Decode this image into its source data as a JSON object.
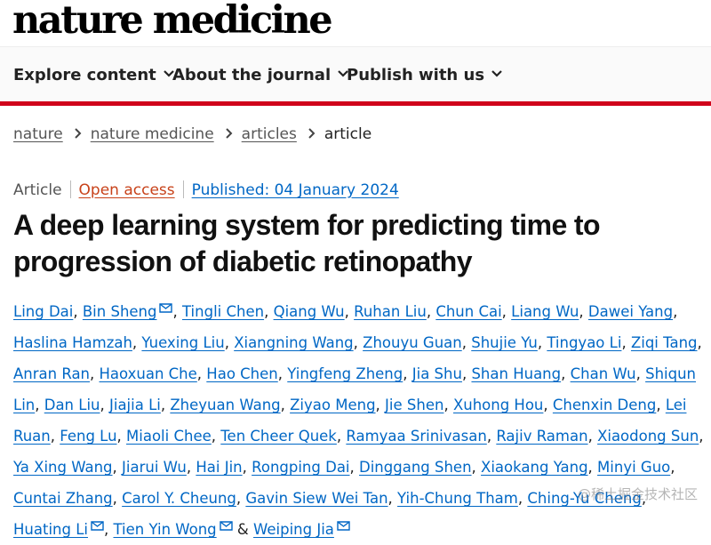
{
  "header": {
    "logo": "nature medicine"
  },
  "nav": {
    "items": [
      {
        "label": "Explore content"
      },
      {
        "label": "About the journal"
      },
      {
        "label": "Publish with us"
      }
    ]
  },
  "breadcrumb": [
    "nature",
    "nature medicine",
    "articles",
    "article"
  ],
  "meta": {
    "type": "Article",
    "access": "Open access",
    "published": "Published: 04 January 2024"
  },
  "article": {
    "title": "A deep learning system for predicting time to progression of diabetic retinopathy"
  },
  "authors": [
    {
      "name": "Ling Dai",
      "mail": false
    },
    {
      "name": "Bin Sheng",
      "mail": true
    },
    {
      "name": "Tingli Chen",
      "mail": false
    },
    {
      "name": "Qiang Wu",
      "mail": false
    },
    {
      "name": "Ruhan Liu",
      "mail": false
    },
    {
      "name": "Chun Cai",
      "mail": false
    },
    {
      "name": "Liang Wu",
      "mail": false
    },
    {
      "name": "Dawei Yang",
      "mail": false
    },
    {
      "name": "Haslina Hamzah",
      "mail": false
    },
    {
      "name": "Yuexing Liu",
      "mail": false
    },
    {
      "name": "Xiangning Wang",
      "mail": false
    },
    {
      "name": "Zhouyu Guan",
      "mail": false
    },
    {
      "name": "Shujie Yu",
      "mail": false
    },
    {
      "name": "Tingyao Li",
      "mail": false
    },
    {
      "name": "Ziqi Tang",
      "mail": false
    },
    {
      "name": "Anran Ran",
      "mail": false
    },
    {
      "name": "Haoxuan Che",
      "mail": false
    },
    {
      "name": "Hao Chen",
      "mail": false
    },
    {
      "name": "Yingfeng Zheng",
      "mail": false
    },
    {
      "name": "Jia Shu",
      "mail": false
    },
    {
      "name": "Shan Huang",
      "mail": false
    },
    {
      "name": "Chan Wu",
      "mail": false
    },
    {
      "name": "Shiqun Lin",
      "mail": false
    },
    {
      "name": "Dan Liu",
      "mail": false
    },
    {
      "name": "Jiajia Li",
      "mail": false
    },
    {
      "name": "Zheyuan Wang",
      "mail": false
    },
    {
      "name": "Ziyao Meng",
      "mail": false
    },
    {
      "name": "Jie Shen",
      "mail": false
    },
    {
      "name": "Xuhong Hou",
      "mail": false
    },
    {
      "name": "Chenxin Deng",
      "mail": false
    },
    {
      "name": "Lei Ruan",
      "mail": false
    },
    {
      "name": "Feng Lu",
      "mail": false
    },
    {
      "name": "Miaoli Chee",
      "mail": false
    },
    {
      "name": "Ten Cheer Quek",
      "mail": false
    },
    {
      "name": "Ramyaa Srinivasan",
      "mail": false
    },
    {
      "name": "Rajiv Raman",
      "mail": false
    },
    {
      "name": "Xiaodong Sun",
      "mail": false
    },
    {
      "name": "Ya Xing Wang",
      "mail": false
    },
    {
      "name": "Jiarui Wu",
      "mail": false
    },
    {
      "name": "Hai Jin",
      "mail": false
    },
    {
      "name": "Rongping Dai",
      "mail": false
    },
    {
      "name": "Dinggang Shen",
      "mail": false
    },
    {
      "name": "Xiaokang Yang",
      "mail": false
    },
    {
      "name": "Minyi Guo",
      "mail": false
    },
    {
      "name": "Cuntai Zhang",
      "mail": false
    },
    {
      "name": "Carol Y. Cheung",
      "mail": false
    },
    {
      "name": "Gavin Siew Wei Tan",
      "mail": false
    },
    {
      "name": "Yih-Chung Tham",
      "mail": false
    },
    {
      "name": "Ching-Yu Cheng",
      "mail": false
    },
    {
      "name": "Huating Li",
      "mail": true
    },
    {
      "name": "Tien Yin Wong",
      "mail": true
    },
    {
      "name": "Weiping Jia",
      "mail": true,
      "prefix": "& "
    }
  ],
  "watermark": "@稀土掘金技术社区",
  "colors": {
    "accent_red": "#d0021b",
    "link_blue": "#0067c5",
    "open_access": "#c8421a"
  }
}
